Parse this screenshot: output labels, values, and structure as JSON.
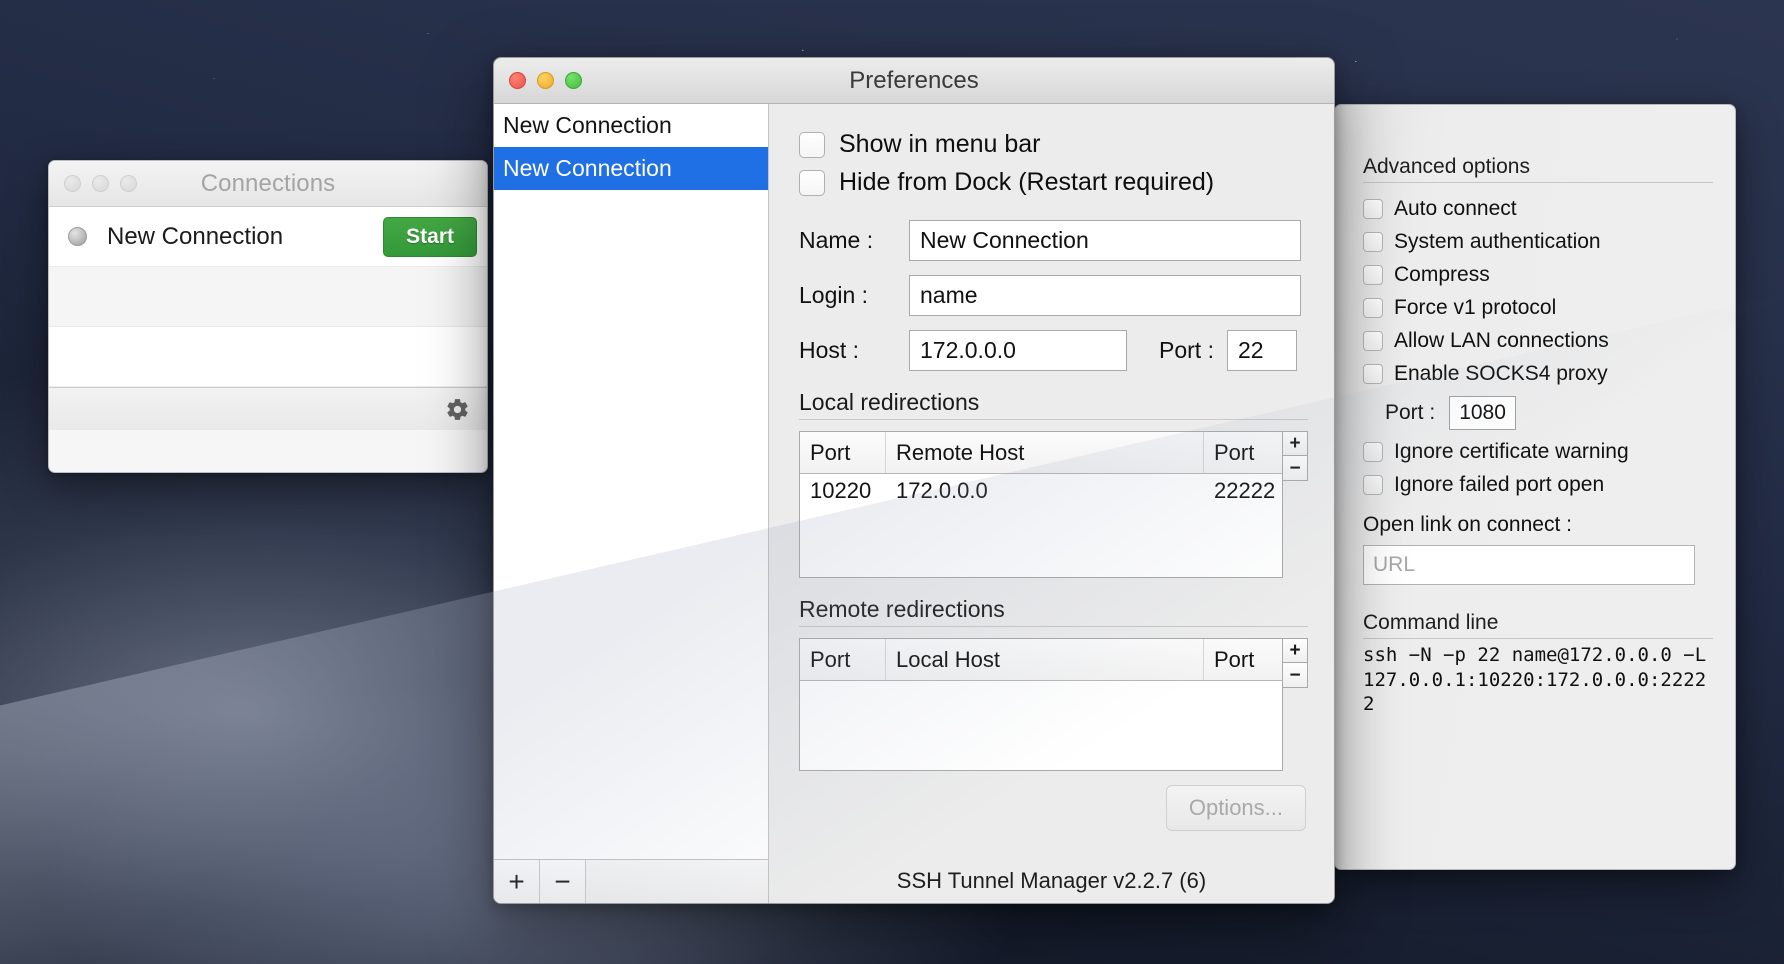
{
  "connections_window": {
    "title": "Connections",
    "rows": [
      {
        "name": "New Connection",
        "action_label": "Start"
      }
    ],
    "gear_icon": "gear-icon",
    "traffic_lights": [
      "close",
      "minimize",
      "zoom"
    ]
  },
  "preferences_window": {
    "title": "Preferences",
    "traffic_lights": [
      "close",
      "minimize",
      "zoom"
    ],
    "sidebar": {
      "items": [
        {
          "label": "New Connection",
          "selected": false
        },
        {
          "label": "New Connection",
          "selected": true
        }
      ],
      "add_label": "+",
      "remove_label": "−"
    },
    "detail": {
      "checkboxes": [
        {
          "label": "Show in menu bar",
          "checked": false
        },
        {
          "label": "Hide from Dock (Restart required)",
          "checked": false
        }
      ],
      "fields": {
        "name_label": "Name :",
        "name_value": "New Connection",
        "login_label": "Login :",
        "login_value": "name",
        "host_label": "Host :",
        "host_value": "172.0.0.0",
        "port_label": "Port :",
        "port_value": "22"
      },
      "local_redirections": {
        "title": "Local redirections",
        "columns": [
          "Port",
          "Remote Host",
          "Port"
        ],
        "rows": [
          [
            "10220",
            "172.0.0.0",
            "22222"
          ]
        ],
        "add_label": "+",
        "remove_label": "−"
      },
      "remote_redirections": {
        "title": "Remote redirections",
        "columns": [
          "Port",
          "Local Host",
          "Port"
        ],
        "rows": [],
        "add_label": "+",
        "remove_label": "−"
      },
      "options_button": "Options...",
      "version": "SSH Tunnel Manager v2.2.7 (6)"
    }
  },
  "advanced_panel": {
    "title": "Advanced options",
    "checkboxes": [
      {
        "label": "Auto connect",
        "checked": false
      },
      {
        "label": "System authentication",
        "checked": false
      },
      {
        "label": "Compress",
        "checked": false
      },
      {
        "label": "Force v1 protocol",
        "checked": false
      },
      {
        "label": "Allow LAN connections",
        "checked": false
      },
      {
        "label": "Enable SOCKS4 proxy",
        "checked": false
      }
    ],
    "socks_port_label": "Port :",
    "socks_port_value": "1080",
    "checkboxes_after": [
      {
        "label": "Ignore certificate warning",
        "checked": false
      },
      {
        "label": "Ignore failed port open",
        "checked": false
      }
    ],
    "open_link_label": "Open link on connect :",
    "open_link_placeholder": "URL",
    "open_link_value": "",
    "command_line_title": "Command line",
    "command_line_text": "ssh −N −p 22 name@172.0.0.0 −L 127.0.0.1:10220:172.0.0.0:22222"
  },
  "colors": {
    "selection_blue": "#1f6fe5",
    "start_green": "#33993a",
    "window_gray": "#ececec",
    "desktop_navy": "#222b44"
  }
}
